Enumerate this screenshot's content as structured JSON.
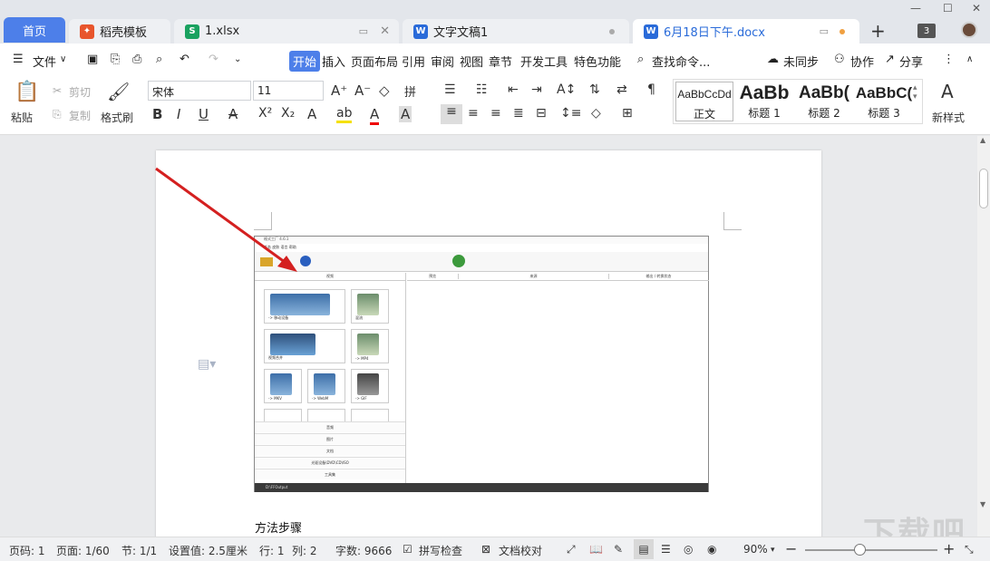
{
  "tabs": {
    "home": "首页",
    "items": [
      {
        "label": "稻壳模板",
        "icon": "docer-icon",
        "color": "#e8552c"
      },
      {
        "label": "1.xlsx",
        "icon": "sheet-icon",
        "color": "#1aa260"
      },
      {
        "label": "文字文稿1",
        "icon": "writer-icon",
        "color": "#2a6bd9"
      },
      {
        "label": "6月18日下午.docx",
        "icon": "writer-icon",
        "color": "#2a6bd9"
      }
    ],
    "badge_count": "3"
  },
  "menu": {
    "file": "文件",
    "items": [
      "开始",
      "插入",
      "页面布局",
      "引用",
      "审阅",
      "视图",
      "章节",
      "开发工具",
      "特色功能"
    ],
    "search": "查找命令...",
    "sync": "未同步",
    "collab": "协作",
    "share": "分享"
  },
  "ribbon": {
    "paste": "粘贴",
    "cut": "剪切",
    "copy": "复制",
    "format_painter": "格式刷",
    "font_name": "宋体",
    "font_size": "11",
    "styles": [
      {
        "sample": "AaBbCcDd",
        "label": "正文"
      },
      {
        "sample": "AaBb",
        "label": "标题 1"
      },
      {
        "sample": "AaBb(",
        "label": "标题 2"
      },
      {
        "sample": "AaBbC(",
        "label": "标题 3"
      }
    ],
    "new_style": "新样式"
  },
  "embedded": {
    "title": "格式工厂 4.6.1",
    "header_left": "视频",
    "header_cols": [
      "预览",
      "来源",
      "输出 / 转换状态"
    ],
    "tiles": [
      "-> 移动设备",
      "混流",
      "视频合并",
      "-> MP4",
      "-> MKV",
      "-> WebM",
      "-> GIF"
    ],
    "categories": [
      "音频",
      "图片",
      "文档",
      "光驱设备\\DVD\\CD\\ISO",
      "工具集"
    ],
    "footer": "D:\\FFOutput"
  },
  "document": {
    "text": "方法步骤"
  },
  "status": {
    "page_code": "页码: 1",
    "page": "页面: 1/60",
    "section": "节: 1/1",
    "setting": "设置值: 2.5厘米",
    "row": "行: 1",
    "col": "列: 2",
    "words": "字数: 9666",
    "spell": "拼写检查",
    "proof": "文档校对",
    "zoom": "90%"
  },
  "watermark": "下载吧"
}
